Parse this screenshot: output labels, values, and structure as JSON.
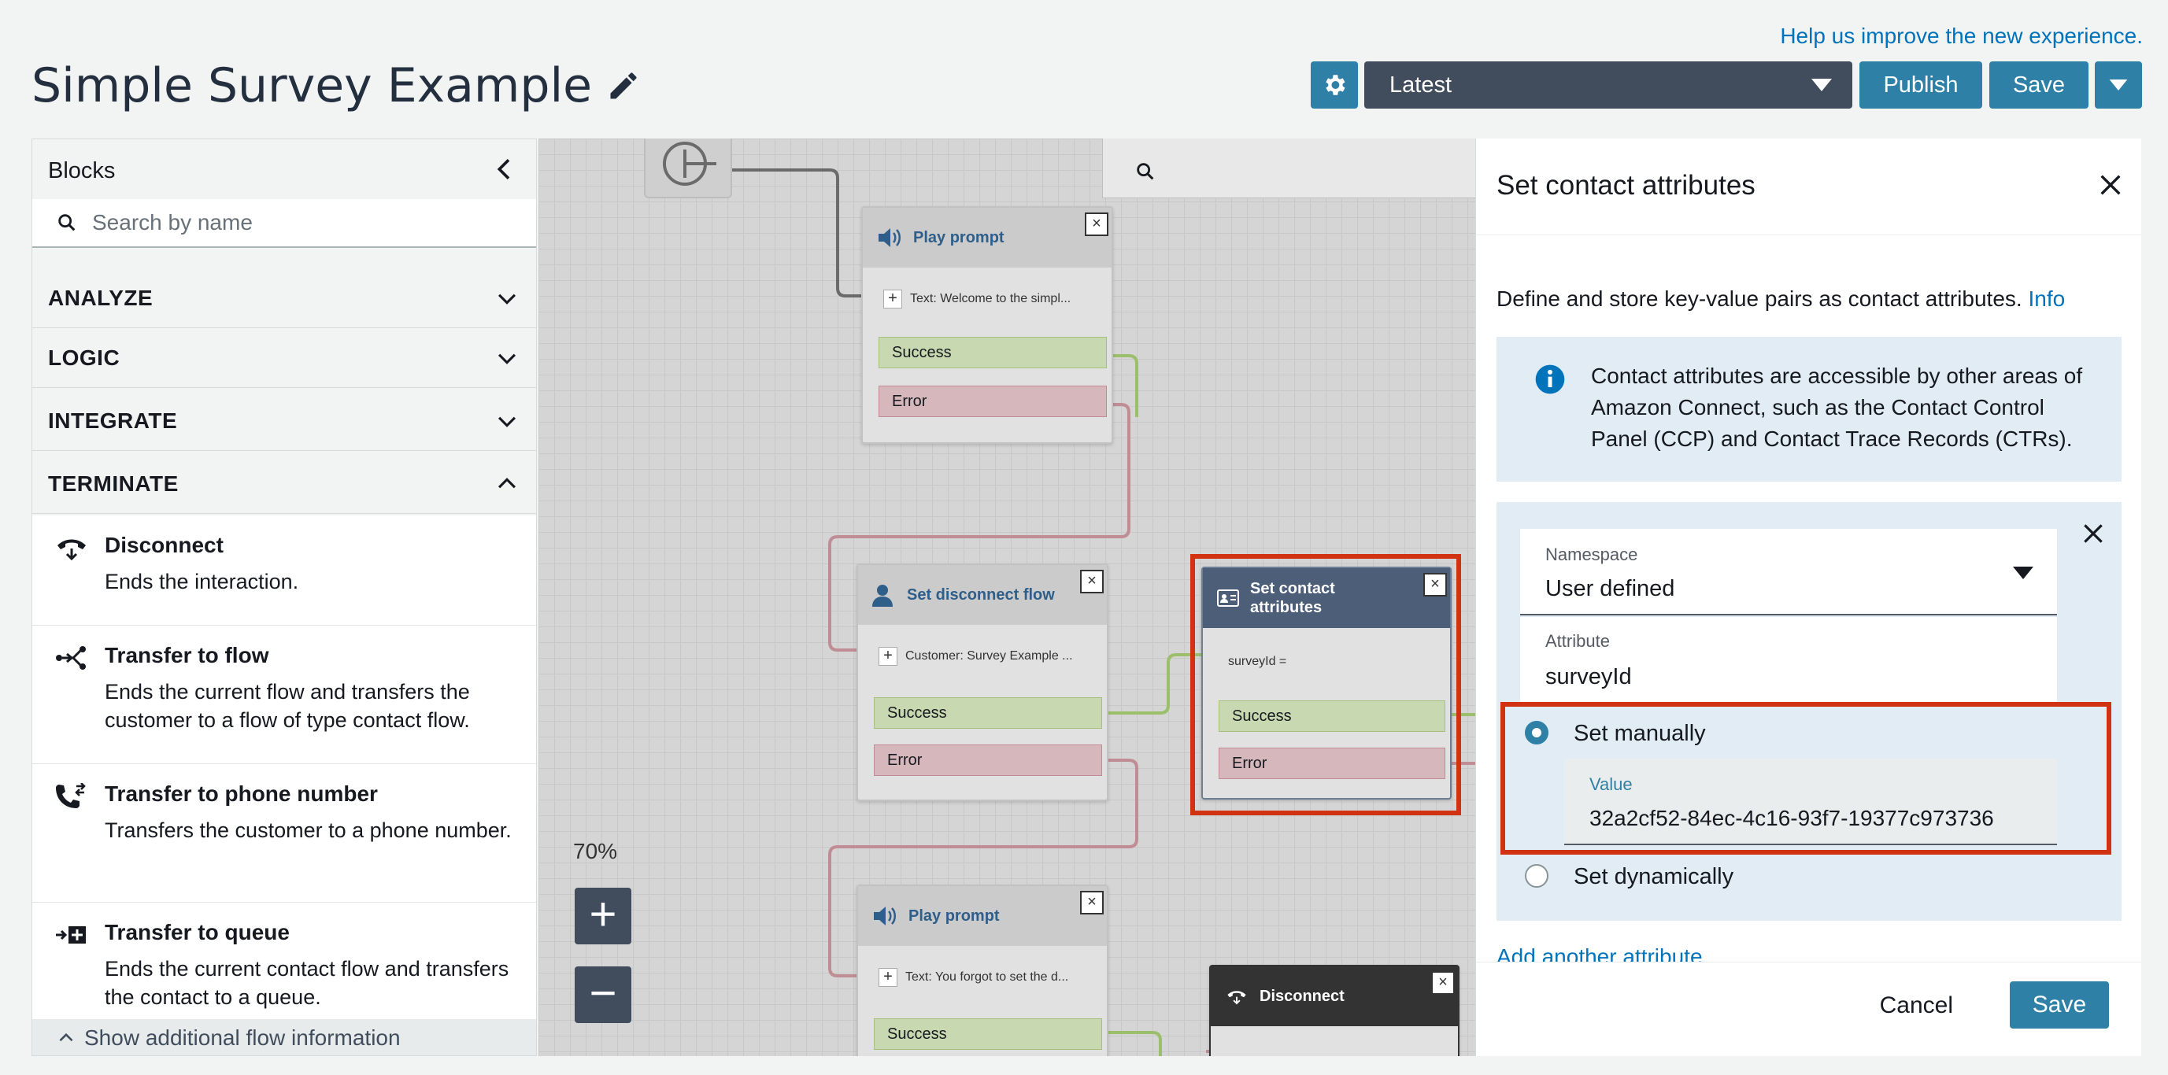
{
  "header": {
    "help_link": "Help us improve the new experience.",
    "title": "Simple Survey Example",
    "version": "Latest",
    "publish_label": "Publish",
    "save_label": "Save"
  },
  "left_panel": {
    "title": "Blocks",
    "search_placeholder": "Search by name",
    "categories": [
      {
        "label": "ANALYZE",
        "expanded": false
      },
      {
        "label": "LOGIC",
        "expanded": false
      },
      {
        "label": "INTEGRATE",
        "expanded": false
      },
      {
        "label": "TERMINATE",
        "expanded": true
      }
    ],
    "terminate_items": [
      {
        "title": "Disconnect",
        "desc": "Ends the interaction.",
        "icon": "disconnect-icon"
      },
      {
        "title": "Transfer to flow",
        "desc": "Ends the current flow and transfers the customer to a flow of type contact flow.",
        "icon": "transfer-flow-icon"
      },
      {
        "title": "Transfer to phone number",
        "desc": "Transfers the customer to a phone number.",
        "icon": "phone-transfer-icon"
      },
      {
        "title": "Transfer to queue",
        "desc": "Ends the current contact flow and transfers the contact to a queue.",
        "icon": "queue-icon"
      }
    ],
    "footer": "Show additional flow information"
  },
  "canvas": {
    "zoom": "70%",
    "blocks": [
      {
        "title": "Play prompt",
        "detail": "Text: Welcome to the simpl...",
        "success": "Success",
        "error": "Error"
      },
      {
        "title": "Set disconnect flow",
        "detail": "Customer: Survey Example ...",
        "success": "Success",
        "error": "Error"
      },
      {
        "title": "Set contact attributes",
        "detail": "surveyId =",
        "success": "Success",
        "error": "Error"
      },
      {
        "title": "Play prompt",
        "detail": "Text: You forgot to set the d...",
        "success": "Success"
      },
      {
        "title": "Disconnect"
      }
    ]
  },
  "right_panel": {
    "title": "Set contact attributes",
    "description": "Define and store key-value pairs as contact attributes.",
    "info_link": "Info",
    "info_text": "Contact attributes are accessible by other areas of Amazon Connect, such as the Contact Control Panel (CCP) and Contact Trace Records (CTRs).",
    "namespace_label": "Namespace",
    "namespace_value": "User defined",
    "attribute_label": "Attribute",
    "attribute_value": "surveyId",
    "set_manually": "Set manually",
    "value_label": "Value",
    "value": "32a2cf52-84ec-4c16-93f7-19377c973736",
    "set_dynamically": "Set dynamically",
    "add_attribute": "Add another attribute",
    "cancel": "Cancel",
    "save": "Save"
  },
  "colors": {
    "accent": "#2e80a6",
    "highlight": "#d13212",
    "link": "#0073bb"
  }
}
